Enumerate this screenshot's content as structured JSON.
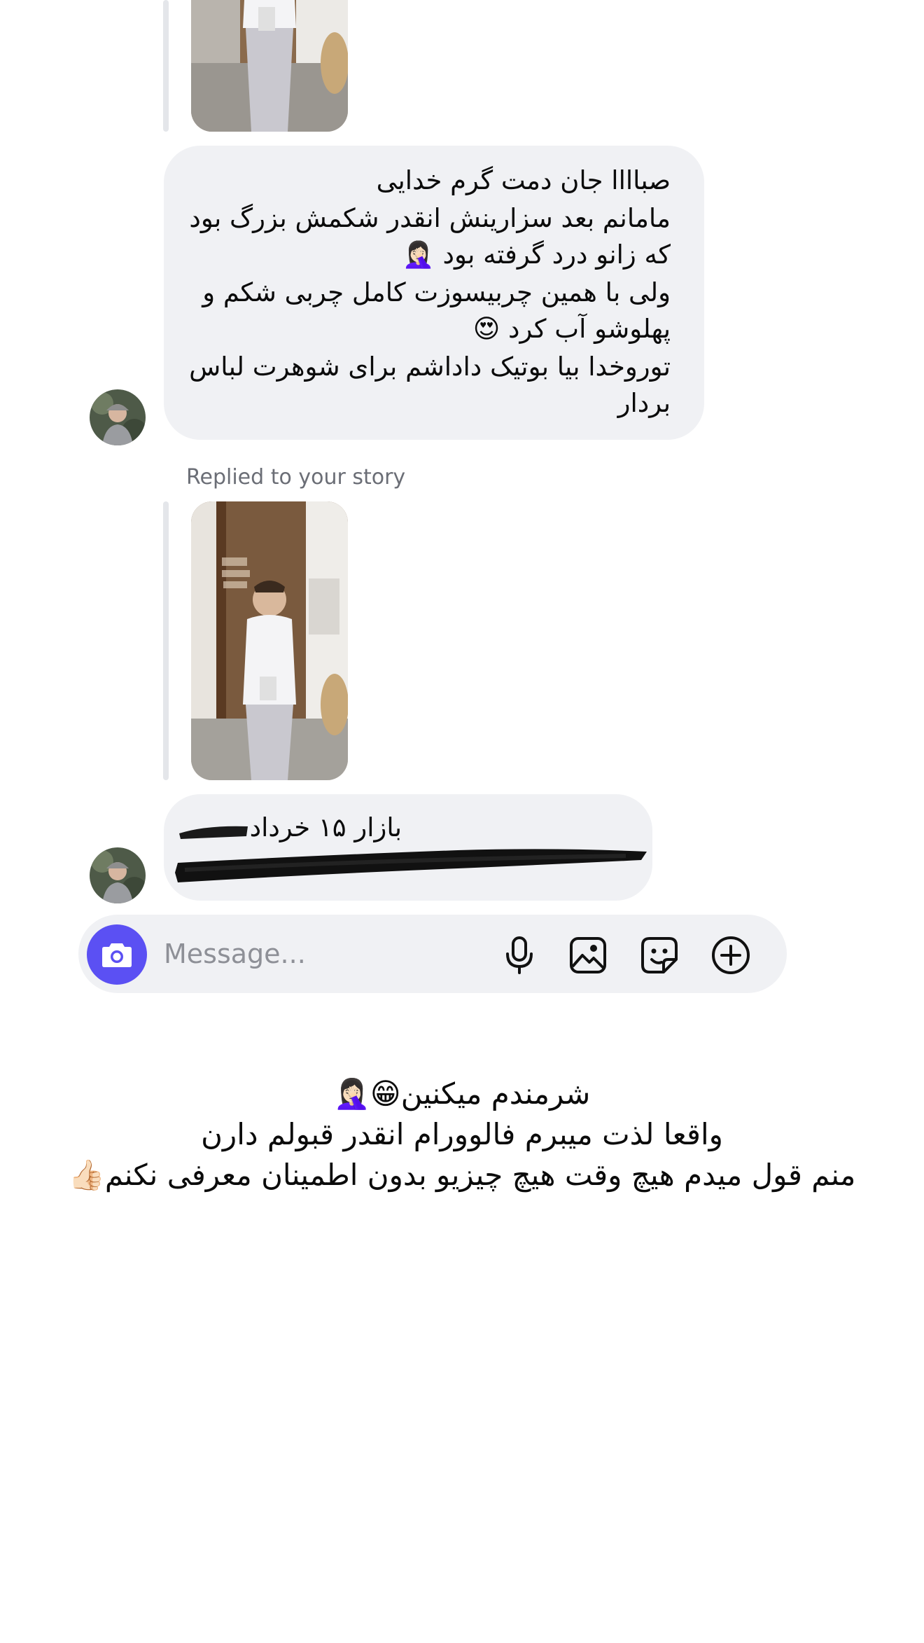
{
  "message1": {
    "lines": [
      "صباااا جان دمت گرم خدایی",
      "مامانم بعد سزارینش انقدر شکمش بزرگ بود",
      "که زانو درد گرفته بود 🤦🏻‍♀️",
      "ولی با همین چربیسوزت کامل چربی شکم و",
      "پهلوشو آب کرد 😍",
      "توروخدا بیا بوتیک داداشم برای شوهرت لباس",
      "بردار"
    ]
  },
  "story_reply_label": "Replied to your story",
  "message2": {
    "line1": "بازار ۱۵ خرداد"
  },
  "composer": {
    "placeholder": "Message..."
  },
  "caption": {
    "lines": [
      "شرمندم میکنین😁🤦🏻‍♀️",
      "واقعا لذت میبرم فالوورام انقدر قبولم دارن",
      "منم قول میدم هیچ وقت هیچ چیزیو بدون اطمینان معرفی نکنم👍🏻"
    ]
  },
  "colors": {
    "bubble": "#f0f1f4",
    "camera_button": "#5b50f3",
    "secondary_text": "#6b6e76"
  }
}
